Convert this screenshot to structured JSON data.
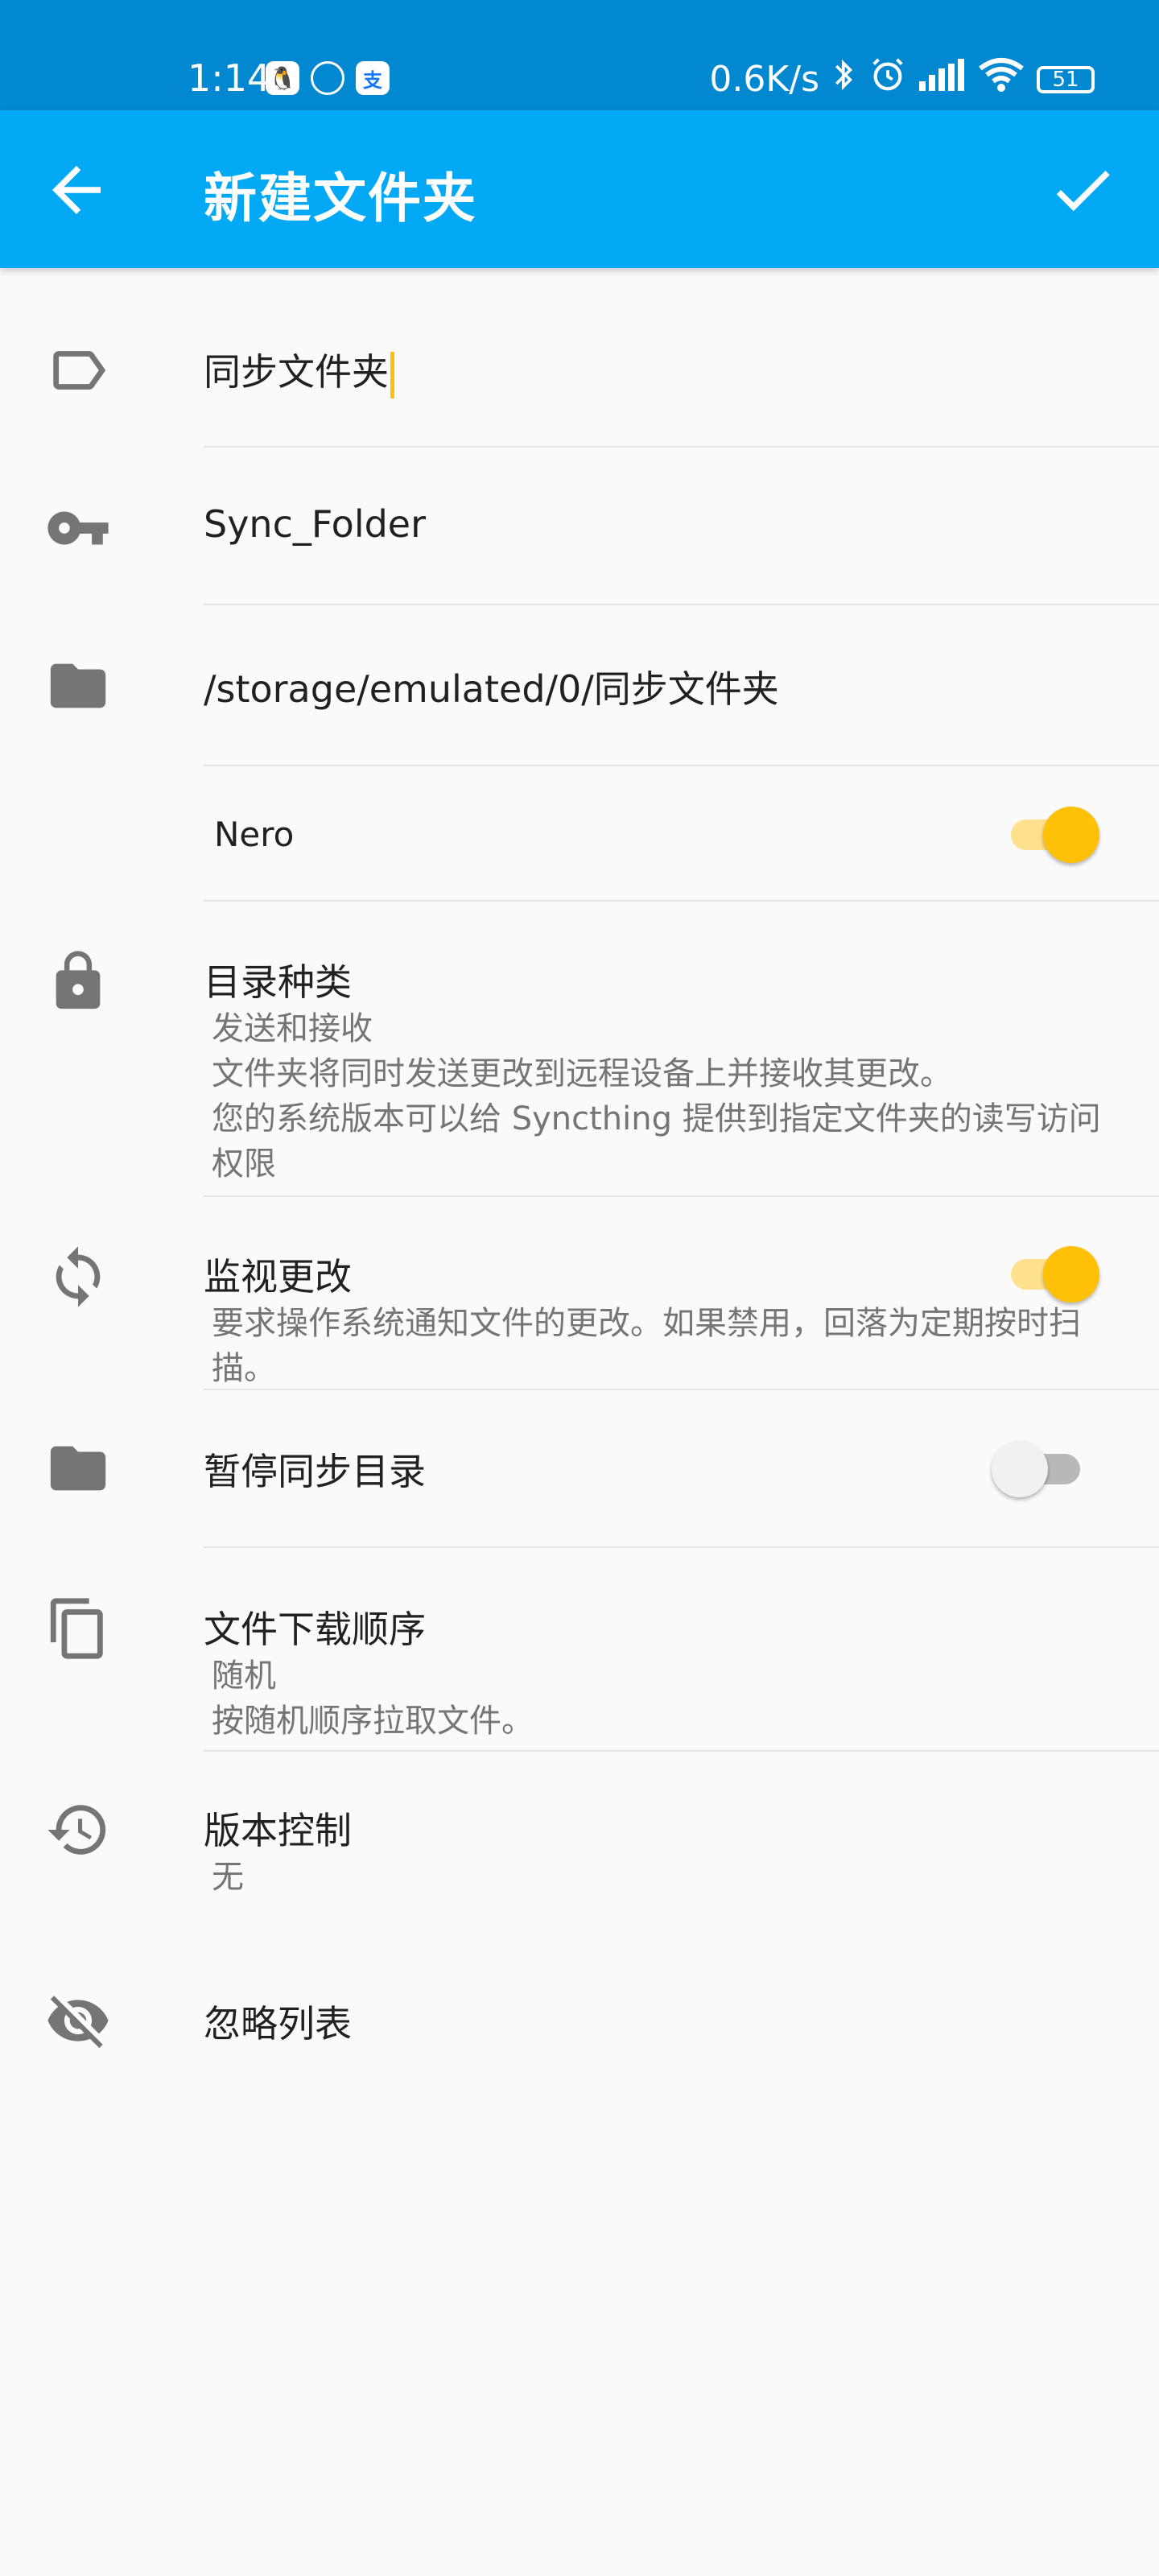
{
  "status_bar": {
    "time": "1:14",
    "net_speed": "0.6K/s",
    "battery": "51"
  },
  "toolbar": {
    "title": "新建文件夹"
  },
  "folder": {
    "label_value": "同步文件夹",
    "id_value": "Sync_Folder",
    "path_value": "/storage/emulated/0/同步文件夹"
  },
  "device": {
    "name": "Nero",
    "enabled": true
  },
  "folder_type": {
    "title": "目录种类",
    "value": "发送和接收",
    "desc": "文件夹将同时发送更改到远程设备上并接收其更改。",
    "note_line1": "您的系统版本可以给 Syncthing 提供到指定文件夹的读写访问",
    "note_line2": "权限"
  },
  "watch_changes": {
    "title": "监视更改",
    "desc_line1": "要求操作系统通知文件的更改。如果禁用，回落为定期按时扫",
    "desc_line2": "描。",
    "enabled": true
  },
  "pause": {
    "title": "暂停同步目录",
    "enabled": false
  },
  "pull_order": {
    "title": "文件下载顺序",
    "value": "随机",
    "desc": "按随机顺序拉取文件。"
  },
  "versioning": {
    "title": "版本控制",
    "value": "无"
  },
  "ignore": {
    "title": "忽略列表"
  },
  "colors": {
    "status_bar": "#0288d1",
    "toolbar": "#03a9f4",
    "accent": "#ffc107",
    "icon_grey": "#757575"
  }
}
